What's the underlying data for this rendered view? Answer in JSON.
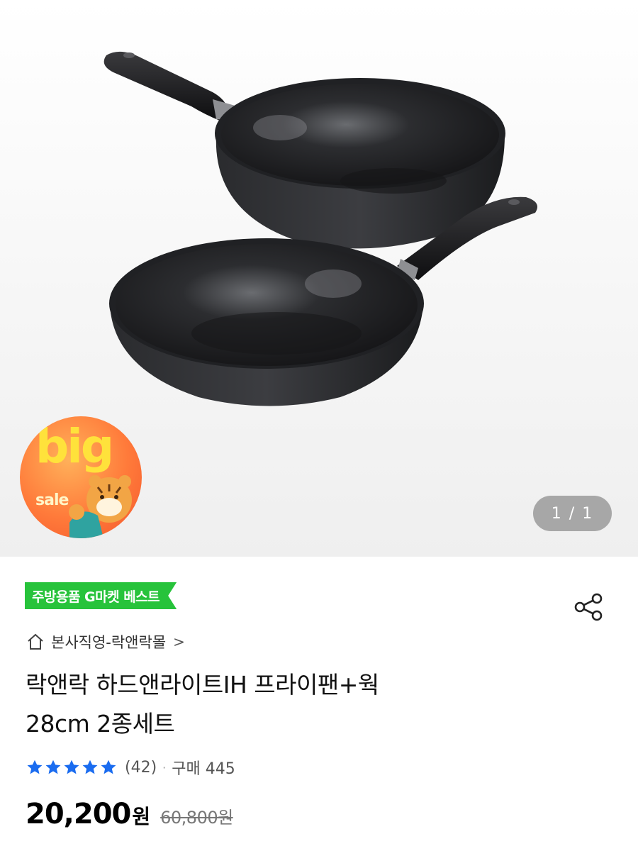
{
  "gallery": {
    "badge": {
      "big": "big",
      "sale": "sale"
    },
    "counter": "1 / 1"
  },
  "product": {
    "best_tag": "주방용품 G마켓 베스트",
    "shop_name": "본사직영-락앤락몰",
    "shop_chevron": ">",
    "title_line1": "락앤락 하드앤라이트IH 프라이팬+웍",
    "title_line2": "28cm 2종세트",
    "rating": {
      "stars": 5,
      "review_count": "(42)",
      "separator": "·",
      "purchase_label": "구매 445"
    },
    "price": {
      "current": "20,200",
      "currency": "원",
      "original": "60,800원"
    }
  },
  "colors": {
    "best_tag": "#27c33b",
    "star": "#1a6cf0",
    "badge": "#ff7a3a"
  },
  "icons": {
    "share": "share-icon",
    "home": "home-icon",
    "star": "star-icon"
  }
}
